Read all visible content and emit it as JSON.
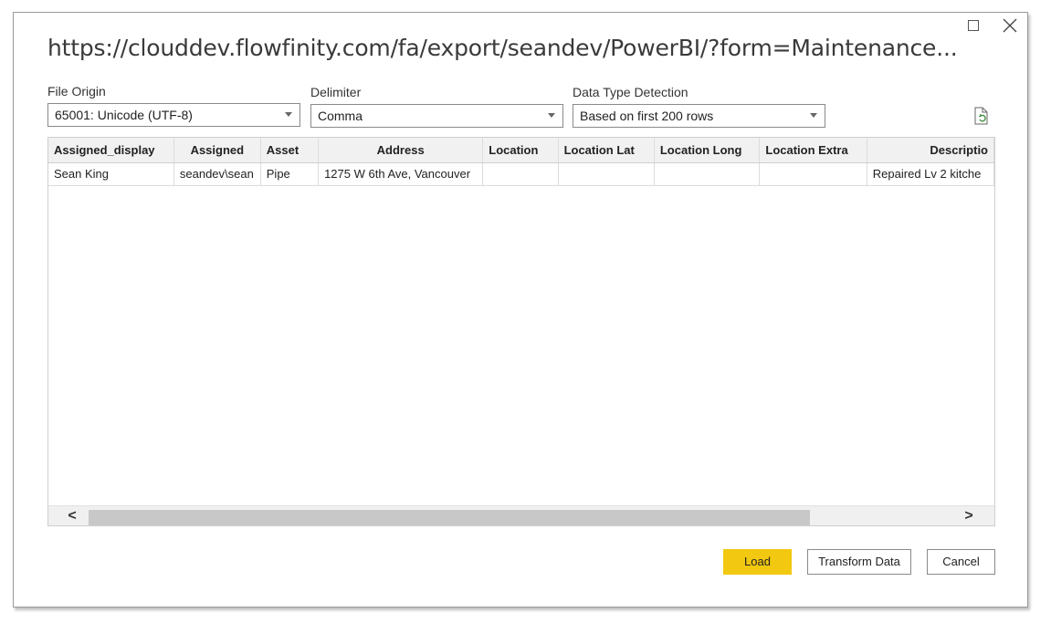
{
  "window": {
    "title": "https://clouddev.flowfinity.com/fa/export/seandev/PowerBI/?form=Maintenance..."
  },
  "options": {
    "file_origin": {
      "label": "File Origin",
      "value": "65001: Unicode (UTF-8)"
    },
    "delimiter": {
      "label": "Delimiter",
      "value": "Comma"
    },
    "data_type_detection": {
      "label": "Data Type Detection",
      "value": "Based on first 200 rows"
    }
  },
  "table": {
    "columns": [
      "Assigned_display",
      "Assigned",
      "Asset",
      "Address",
      "Location",
      "Location Lat",
      "Location Long",
      "Location Extra",
      "Descriptio"
    ],
    "rows": [
      [
        "Sean King",
        "seandev\\sean",
        "Pipe",
        "1275 W 6th Ave, Vancouver",
        "",
        "",
        "",
        "",
        "Repaired Lv 2 kitche"
      ]
    ]
  },
  "scrollbar": {
    "left_arrow": "<",
    "right_arrow": ">"
  },
  "buttons": {
    "load": "Load",
    "transform": "Transform Data",
    "cancel": "Cancel"
  },
  "colors": {
    "accent": "#f2c811"
  }
}
